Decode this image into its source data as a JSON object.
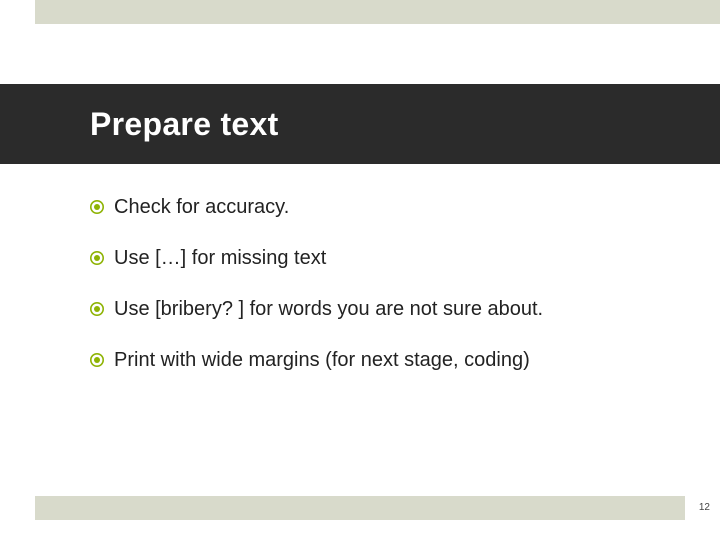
{
  "title": "Prepare text",
  "bullets": [
    "Check for accuracy.",
    "Use […] for missing text",
    "Use [bribery? ] for words you are not sure about.",
    "Print with wide margins (for next stage, coding)"
  ],
  "page_number": "12"
}
